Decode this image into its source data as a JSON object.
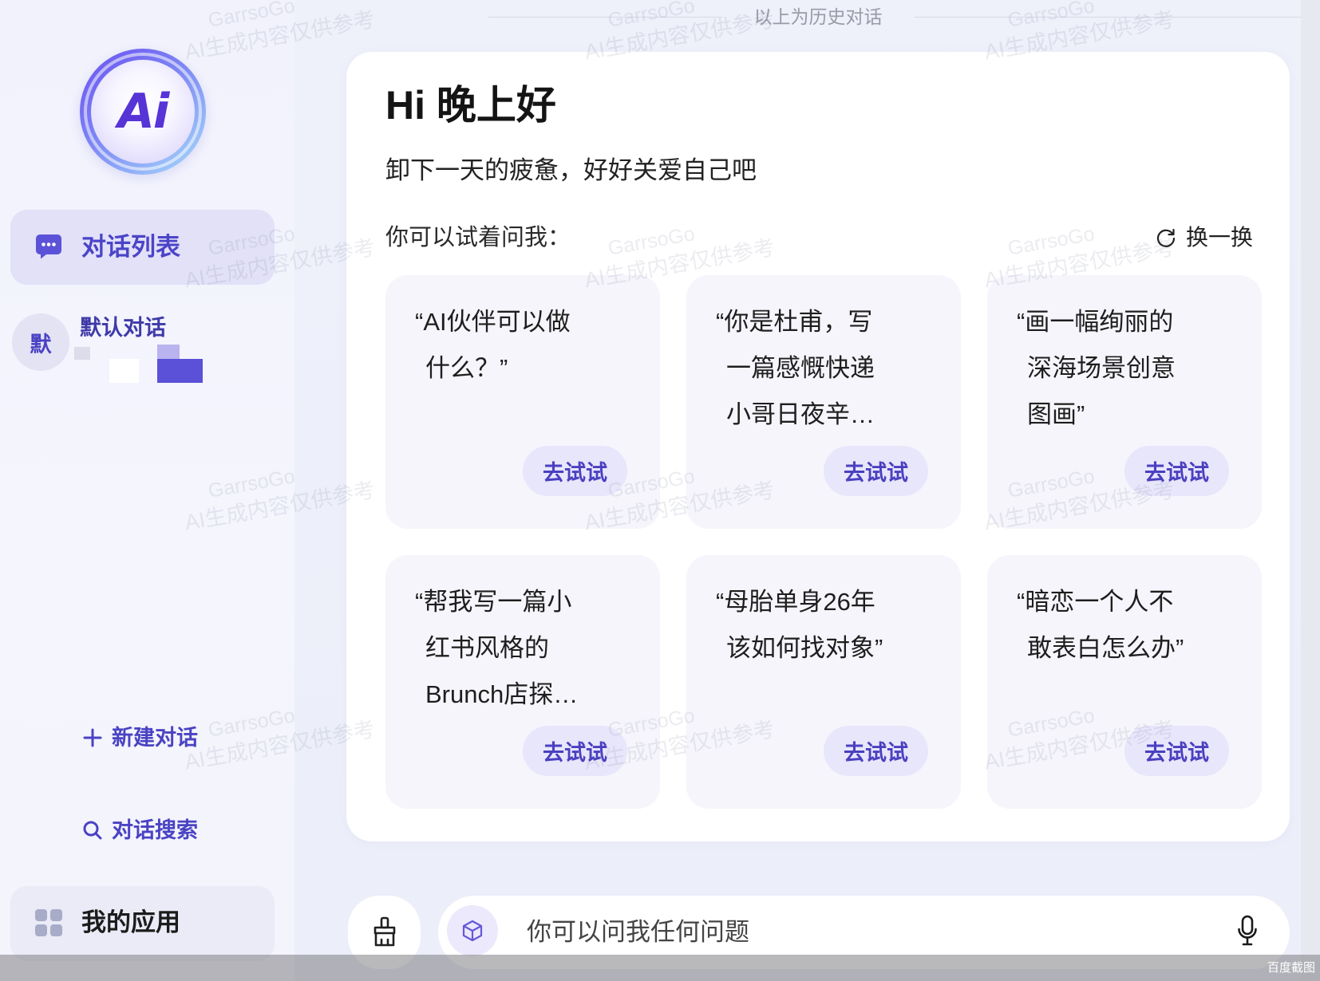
{
  "history_divider": "以上为历史对话",
  "watermark": {
    "line1": "GarrsoGo",
    "line2": "AI生成内容仅供参考"
  },
  "sidebar": {
    "logo_text": "Ai",
    "nav": {
      "label": "对话列表",
      "icon": "chat-bubble-icon",
      "active": true
    },
    "conversations": [
      {
        "avatar": "默",
        "title": "默认对话"
      }
    ],
    "new_chat": {
      "label": "新建对话",
      "icon": "plus-icon"
    },
    "search": {
      "label": "对话搜索",
      "icon": "search-icon"
    },
    "my_apps": {
      "label": "我的应用",
      "icon": "grid-icon"
    }
  },
  "main": {
    "greeting": "Hi 晚上好",
    "subtitle": "卸下一天的疲惫，好好关爱自己吧",
    "suggest_label": "你可以试着问我：",
    "refresh": {
      "label": "换一换",
      "icon": "refresh-icon"
    },
    "cards": [
      {
        "lines": [
          "“AI伙伴可以做",
          "什么？”"
        ],
        "button": "去试试"
      },
      {
        "lines": [
          "“你是杜甫，写",
          "一篇感慨快递",
          "小哥日夜辛…"
        ],
        "button": "去试试"
      },
      {
        "lines": [
          "“画一幅绚丽的",
          "深海场景创意",
          "图画”"
        ],
        "button": "去试试"
      },
      {
        "lines": [
          "“帮我写一篇小",
          "红书风格的",
          "Brunch店探…"
        ],
        "button": "去试试"
      },
      {
        "lines": [
          "“母胎单身26年",
          "该如何找对象”"
        ],
        "button": "去试试"
      },
      {
        "lines": [
          "“暗恋一个人不",
          "敢表白怎么办”"
        ],
        "button": "去试试"
      }
    ]
  },
  "composer": {
    "placeholder": "你可以问我任何问题",
    "clear_icon": "broom-icon",
    "plugin_icon": "cube-icon",
    "mic_icon": "microphone-icon"
  },
  "screenshot_tool": {
    "label": "百度截图"
  },
  "colors": {
    "page_bg": "#eef0f9",
    "sidebar_bg": "#f3f4fc",
    "accent": "#4a42c4",
    "nav_active_bg": "#e2e1f8",
    "card_bg": "#f5f5fb",
    "pill_bg": "#e8e6fb",
    "pill_text": "#4a40c0",
    "text_primary": "#1e1e1e"
  }
}
